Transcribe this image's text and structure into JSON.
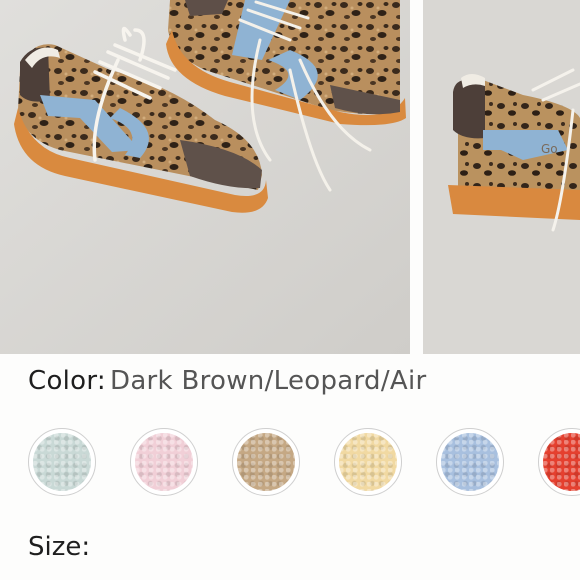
{
  "gallery": {
    "images": [
      {
        "icon": "leopard-sneaker-pair-photo"
      },
      {
        "icon": "leopard-sneaker-side-photo"
      }
    ]
  },
  "color": {
    "label": "Color:",
    "selected": "Dark Brown/Leopard/Air"
  },
  "swatches": [
    {
      "color": "#c9d9d6"
    },
    {
      "color": "#f1cfd7"
    },
    {
      "color": "#c5a884"
    },
    {
      "color": "#f1d9a2"
    },
    {
      "color": "#a8c0df"
    },
    {
      "color": "#e5402f"
    }
  ],
  "size": {
    "label": "Size:"
  }
}
